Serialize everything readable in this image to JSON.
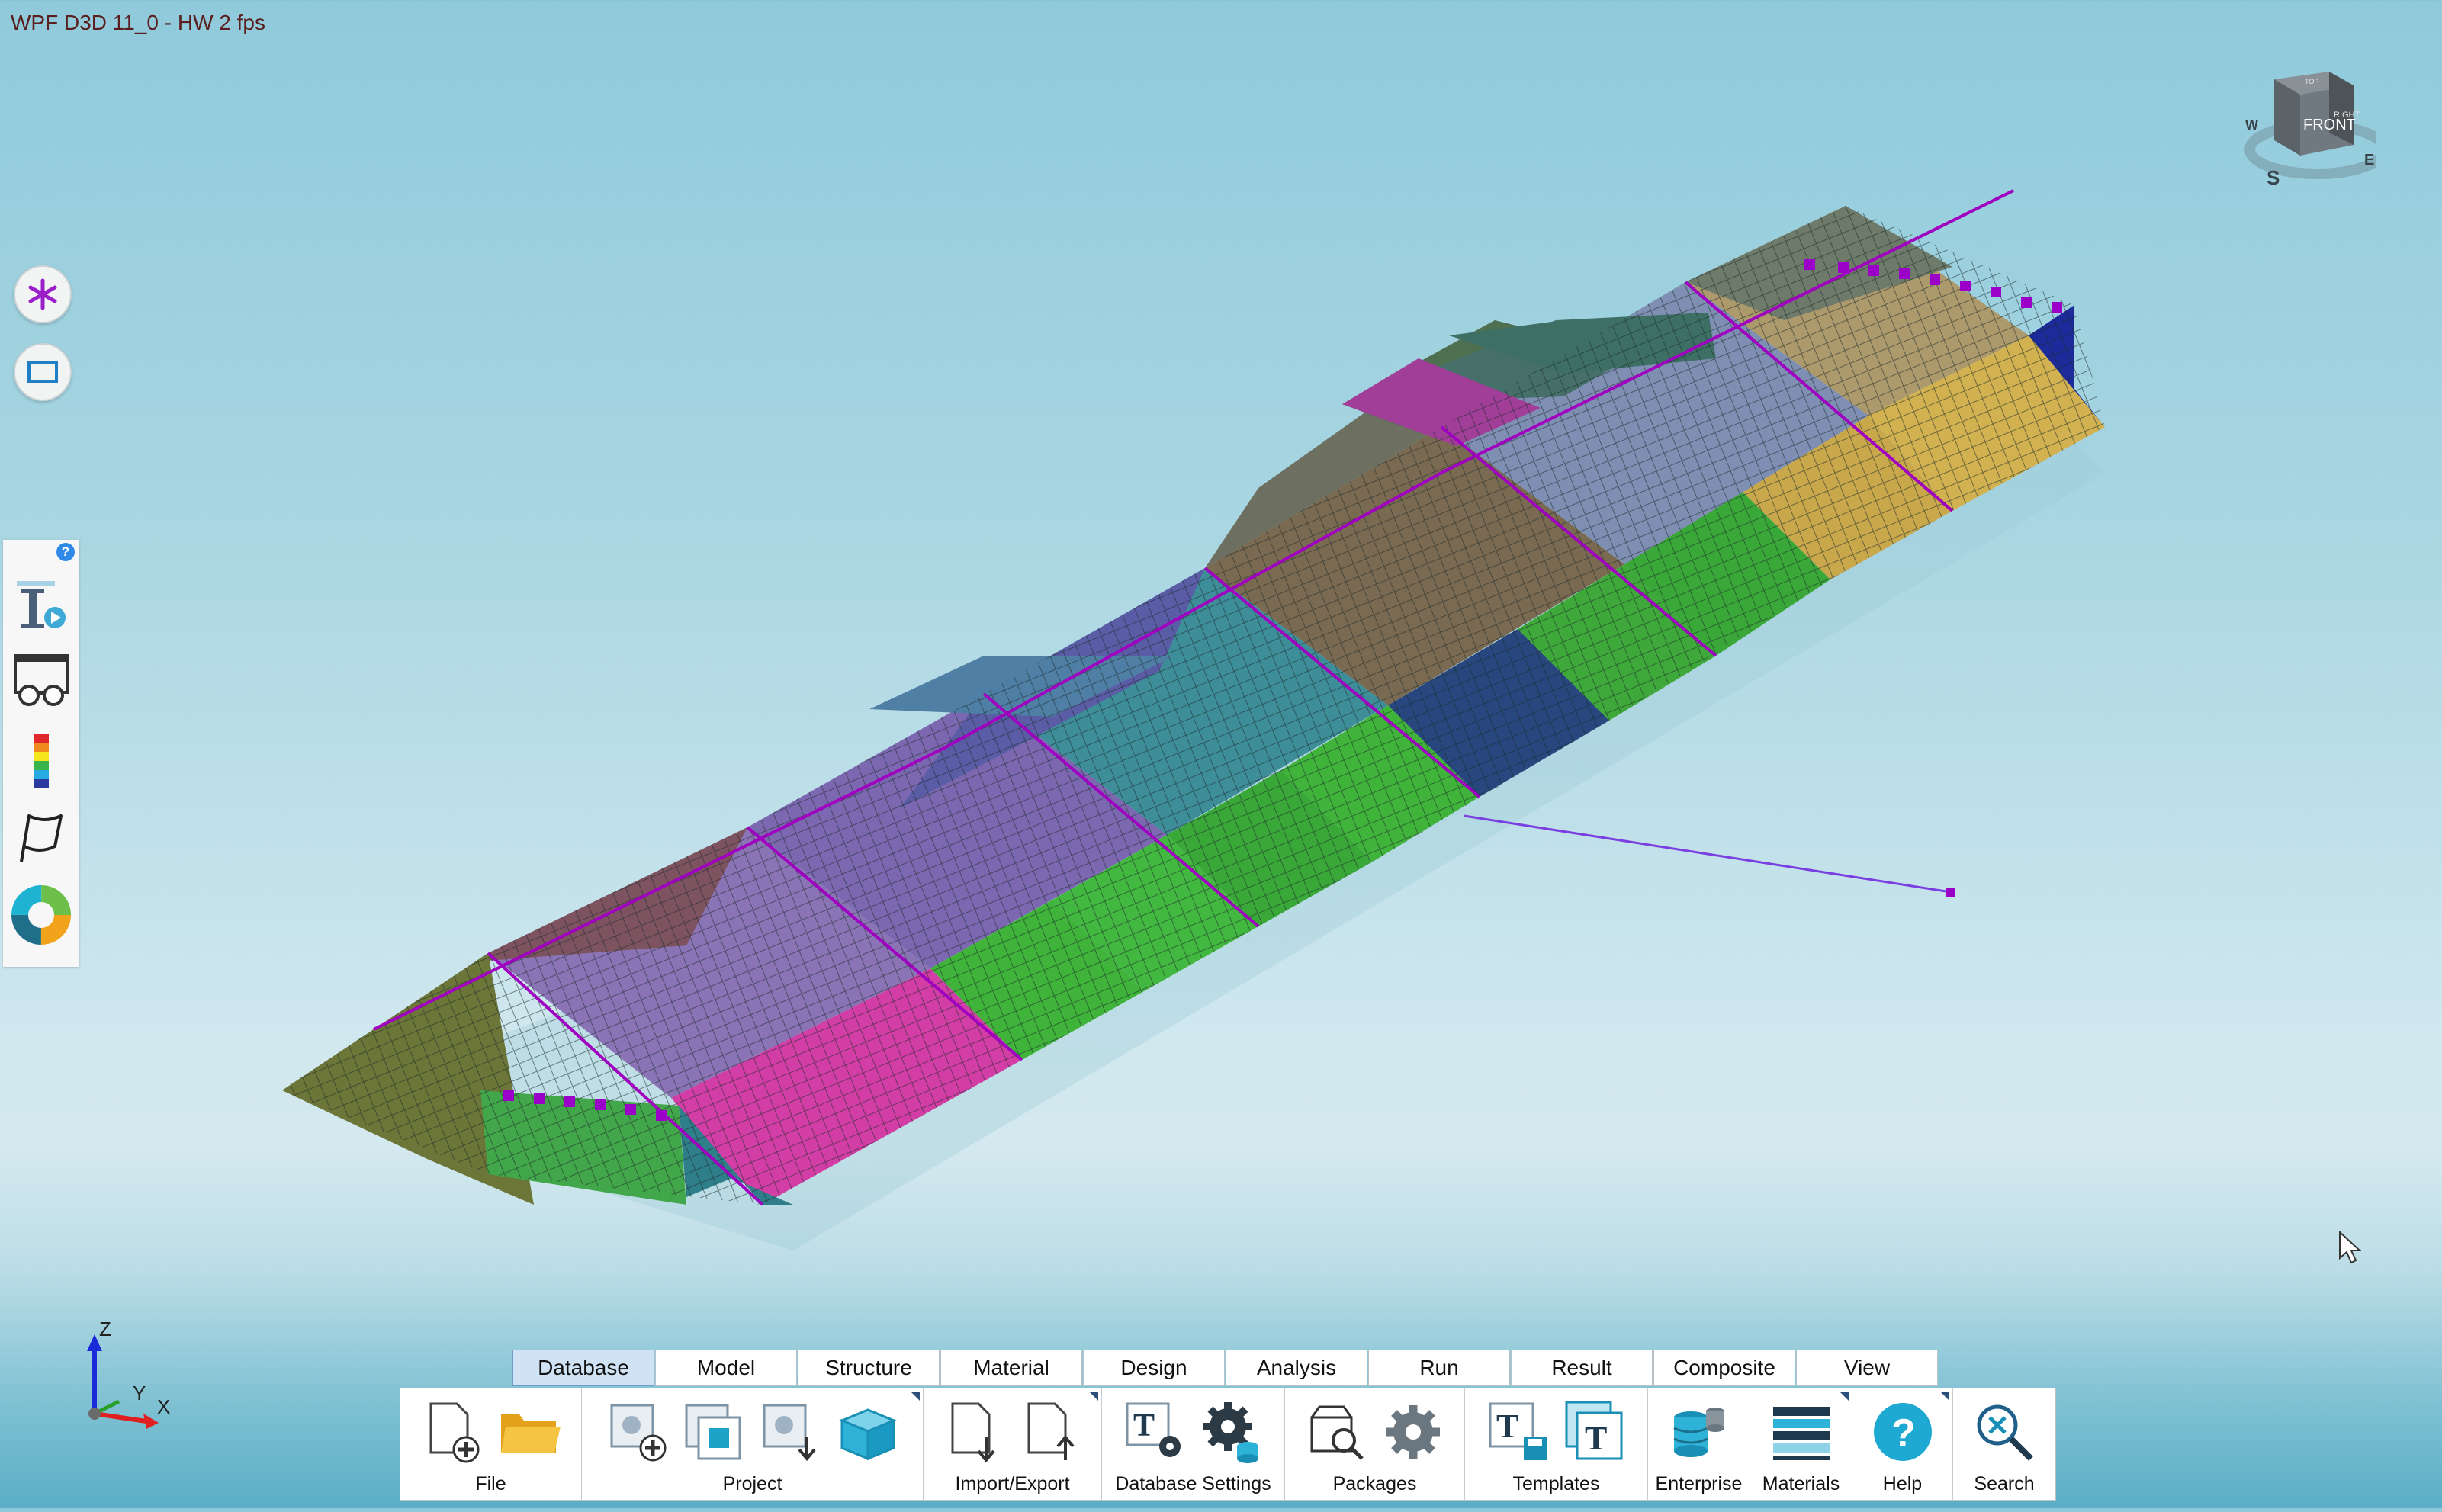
{
  "window": {
    "title": "WPF D3D 11_0 - HW  2  fps"
  },
  "viewcube": {
    "face_front": "FRONT",
    "face_top": "TOP",
    "face_right": "RIGHT",
    "compass_w": "W",
    "compass_s": "S",
    "compass_e": "E"
  },
  "left_buttons": [
    {
      "icon": "asterisk-icon"
    },
    {
      "icon": "rectangle-select-icon"
    }
  ],
  "tool_panel": {
    "help_badge": "?",
    "tools": [
      {
        "icon": "info-play-icon"
      },
      {
        "icon": "glasses-view-icon"
      },
      {
        "icon": "color-legend-icon"
      },
      {
        "icon": "flag-icon"
      },
      {
        "icon": "color-wheel-icon"
      }
    ]
  },
  "axes": {
    "z": "Z",
    "y": "Y",
    "x": "X"
  },
  "ribbon": {
    "tabs": [
      {
        "label": "Database",
        "active": true
      },
      {
        "label": "Model"
      },
      {
        "label": "Structure"
      },
      {
        "label": "Material"
      },
      {
        "label": "Design"
      },
      {
        "label": "Analysis"
      },
      {
        "label": "Run"
      },
      {
        "label": "Result"
      },
      {
        "label": "Composite"
      },
      {
        "label": "View"
      }
    ],
    "groups": [
      {
        "label": "File",
        "icons": [
          "new-file-icon",
          "open-folder-icon"
        ]
      },
      {
        "label": "Project",
        "icons": [
          "new-project-icon",
          "project-window-icon",
          "project-download-icon",
          "package-box-icon"
        ]
      },
      {
        "label": "Import/Export",
        "icons": [
          "import-icon",
          "export-icon"
        ]
      },
      {
        "label": "Database Settings",
        "icons": [
          "text-gear-icon",
          "gears-database-icon"
        ]
      },
      {
        "label": "Packages",
        "icons": [
          "package-search-icon",
          "package-gear-icon"
        ]
      },
      {
        "label": "Templates",
        "icons": [
          "template-save-icon",
          "template-icon"
        ]
      },
      {
        "label": "Enterprise",
        "icons": [
          "enterprise-database-icon"
        ]
      },
      {
        "label": "Materials",
        "icons": [
          "materials-layers-icon"
        ]
      },
      {
        "label": "Help",
        "icons": [
          "help-icon"
        ]
      },
      {
        "label": "Search",
        "icons": [
          "search-icon"
        ]
      }
    ]
  },
  "colors": {
    "accent": "#cfe3f4",
    "marker": "#9b00c8"
  }
}
